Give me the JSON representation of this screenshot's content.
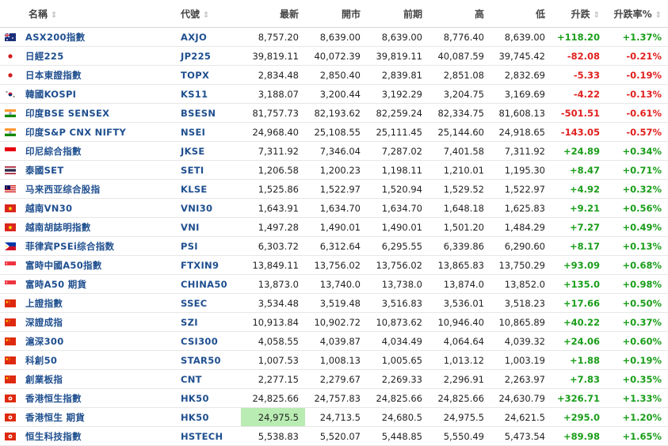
{
  "headers": {
    "name": "名稱",
    "code": "代號",
    "last": "最新",
    "open": "開市",
    "prev": "前期",
    "high": "高",
    "low": "低",
    "change": "升跌",
    "change_pct": "升跌率%"
  },
  "rows": [
    {
      "flag": "australia-flag",
      "name": "ASX200指數",
      "code": "AXJO",
      "last": "8,757.20",
      "open": "8,639.00",
      "prev": "8,639.00",
      "high": "8,776.40",
      "low": "8,639.00",
      "chg": "+118.20",
      "pct": "+1.37%",
      "dir": "up"
    },
    {
      "flag": "japan-flag",
      "name": "日經225",
      "code": "JP225",
      "last": "39,819.11",
      "open": "40,072.39",
      "prev": "39,819.11",
      "high": "40,087.59",
      "low": "39,745.42",
      "chg": "-82.08",
      "pct": "-0.21%",
      "dir": "down"
    },
    {
      "flag": "japan-flag",
      "name": "日本東證指數",
      "code": "TOPX",
      "last": "2,834.48",
      "open": "2,850.40",
      "prev": "2,839.81",
      "high": "2,851.08",
      "low": "2,832.69",
      "chg": "-5.33",
      "pct": "-0.19%",
      "dir": "down"
    },
    {
      "flag": "korea-flag",
      "name": "韓國KOSPI",
      "code": "KS11",
      "last": "3,188.07",
      "open": "3,200.44",
      "prev": "3,192.29",
      "high": "3,204.75",
      "low": "3,169.69",
      "chg": "-4.22",
      "pct": "-0.13%",
      "dir": "down"
    },
    {
      "flag": "india-flag",
      "name": "印度BSE SENSEX",
      "code": "BSESN",
      "last": "81,757.73",
      "open": "82,193.62",
      "prev": "82,259.24",
      "high": "82,334.75",
      "low": "81,608.13",
      "chg": "-501.51",
      "pct": "-0.61%",
      "dir": "down"
    },
    {
      "flag": "india-flag",
      "name": "印度S&P CNX NIFTY",
      "code": "NSEI",
      "last": "24,968.40",
      "open": "25,108.55",
      "prev": "25,111.45",
      "high": "25,144.60",
      "low": "24,918.65",
      "chg": "-143.05",
      "pct": "-0.57%",
      "dir": "down"
    },
    {
      "flag": "indonesia-flag",
      "name": "印尼綜合指數",
      "code": "JKSE",
      "last": "7,311.92",
      "open": "7,346.04",
      "prev": "7,287.02",
      "high": "7,401.58",
      "low": "7,311.92",
      "chg": "+24.89",
      "pct": "+0.34%",
      "dir": "up"
    },
    {
      "flag": "thailand-flag",
      "name": "泰國SET",
      "code": "SETI",
      "last": "1,206.58",
      "open": "1,200.23",
      "prev": "1,198.11",
      "high": "1,210.01",
      "low": "1,195.30",
      "chg": "+8.47",
      "pct": "+0.71%",
      "dir": "up"
    },
    {
      "flag": "malaysia-flag",
      "name": "马来西亚综合股指",
      "code": "KLSE",
      "last": "1,525.86",
      "open": "1,522.97",
      "prev": "1,520.94",
      "high": "1,529.52",
      "low": "1,522.97",
      "chg": "+4.92",
      "pct": "+0.32%",
      "dir": "up"
    },
    {
      "flag": "vietnam-flag",
      "name": "越南VN30",
      "code": "VNI30",
      "last": "1,643.91",
      "open": "1,634.70",
      "prev": "1,634.70",
      "high": "1,648.18",
      "low": "1,625.83",
      "chg": "+9.21",
      "pct": "+0.56%",
      "dir": "up"
    },
    {
      "flag": "vietnam-flag",
      "name": "越南胡誌明指數",
      "code": "VNI",
      "last": "1,497.28",
      "open": "1,490.01",
      "prev": "1,490.01",
      "high": "1,501.20",
      "low": "1,484.29",
      "chg": "+7.27",
      "pct": "+0.49%",
      "dir": "up"
    },
    {
      "flag": "philippines-flag",
      "name": "菲律宾PSEi综合指数",
      "code": "PSI",
      "last": "6,303.72",
      "open": "6,312.64",
      "prev": "6,295.55",
      "high": "6,339.86",
      "low": "6,290.60",
      "chg": "+8.17",
      "pct": "+0.13%",
      "dir": "up"
    },
    {
      "flag": "singapore-flag",
      "name": "富時中國A50指數",
      "code": "FTXIN9",
      "last": "13,849.11",
      "open": "13,756.02",
      "prev": "13,756.02",
      "high": "13,865.83",
      "low": "13,750.29",
      "chg": "+93.09",
      "pct": "+0.68%",
      "dir": "up"
    },
    {
      "flag": "singapore-flag",
      "name": "富時A50 期貨",
      "code": "CHINA50",
      "last": "13,873.0",
      "open": "13,740.0",
      "prev": "13,738.0",
      "high": "13,874.0",
      "low": "13,852.0",
      "chg": "+135.0",
      "pct": "+0.98%",
      "dir": "up"
    },
    {
      "flag": "china-flag",
      "name": "上證指數",
      "code": "SSEC",
      "last": "3,534.48",
      "open": "3,519.48",
      "prev": "3,516.83",
      "high": "3,536.01",
      "low": "3,518.23",
      "chg": "+17.66",
      "pct": "+0.50%",
      "dir": "up"
    },
    {
      "flag": "china-flag",
      "name": "深證成指",
      "code": "SZI",
      "last": "10,913.84",
      "open": "10,902.72",
      "prev": "10,873.62",
      "high": "10,946.40",
      "low": "10,865.89",
      "chg": "+40.22",
      "pct": "+0.37%",
      "dir": "up"
    },
    {
      "flag": "china-flag",
      "name": "滬深300",
      "code": "CSI300",
      "last": "4,058.55",
      "open": "4,039.87",
      "prev": "4,034.49",
      "high": "4,064.64",
      "low": "4,039.32",
      "chg": "+24.06",
      "pct": "+0.60%",
      "dir": "up"
    },
    {
      "flag": "china-flag",
      "name": "科創50",
      "code": "STAR50",
      "last": "1,007.53",
      "open": "1,008.13",
      "prev": "1,005.65",
      "high": "1,013.12",
      "low": "1,003.19",
      "chg": "+1.88",
      "pct": "+0.19%",
      "dir": "up"
    },
    {
      "flag": "china-flag",
      "name": "創業板指",
      "code": "CNT",
      "last": "2,277.15",
      "open": "2,279.67",
      "prev": "2,269.33",
      "high": "2,296.91",
      "low": "2,263.97",
      "chg": "+7.83",
      "pct": "+0.35%",
      "dir": "up"
    },
    {
      "flag": "hongkong-flag",
      "name": "香港恒生指數",
      "code": "HK50",
      "last": "24,825.66",
      "open": "24,757.83",
      "prev": "24,825.66",
      "high": "24,825.66",
      "low": "24,630.79",
      "chg": "+326.71",
      "pct": "+1.33%",
      "dir": "up"
    },
    {
      "flag": "hongkong-flag",
      "name": "香港恒生 期貨",
      "code": "HK50",
      "last": "24,975.5",
      "open": "24,713.5",
      "prev": "24,680.5",
      "high": "24,975.5",
      "low": "24,621.5",
      "chg": "+295.0",
      "pct": "+1.20%",
      "dir": "up",
      "highlight": true
    },
    {
      "flag": "hongkong-flag",
      "name": "恒生科技指數",
      "code": "HSTECH",
      "last": "5,538.83",
      "open": "5,520.07",
      "prev": "5,448.85",
      "high": "5,550.49",
      "low": "5,473.54",
      "chg": "+89.98",
      "pct": "+1.65%",
      "dir": "up"
    }
  ],
  "colors": {
    "up": "#1a9e1a",
    "down": "#e0201e",
    "link": "#1f4f8f",
    "highlight": "#b9ecb2"
  }
}
